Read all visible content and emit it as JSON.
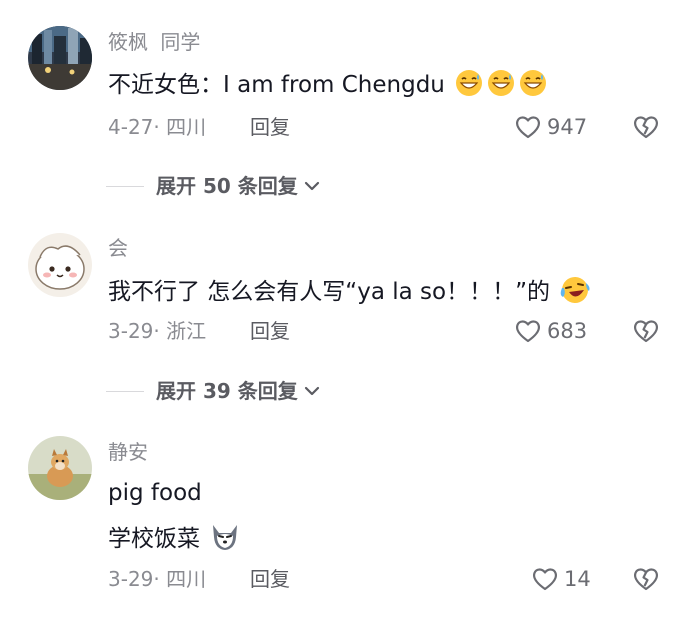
{
  "comments": [
    {
      "name": "筱枫",
      "tag": "同学",
      "text": "不近女色：I am from Chengdu",
      "date_location": "4-27· 四川",
      "reply_label": "回复",
      "likes": "947"
    },
    {
      "name": "会",
      "text": "我不行了  怎么会有人写“ya la so！！！”的",
      "date_location": "3-29· 浙江",
      "reply_label": "回复",
      "likes": "683"
    },
    {
      "name": "静安",
      "text_line1": "pig food",
      "text_line2": "学校饭菜",
      "date_location": "3-29· 四川",
      "reply_label": "回复",
      "likes": "14"
    }
  ],
  "expand_replies": [
    {
      "label": "展开 50 条回复"
    },
    {
      "label": "展开 39 条回复"
    }
  ],
  "icons": {
    "like": "heart-outline-icon",
    "dislike": "broken-heart-icon",
    "expand": "chevron-down-icon",
    "emoji_1": "grinning-sweat-emoji",
    "emoji_2": "laughing-crying-emoji",
    "emoji_3": "wolf-emoji"
  }
}
